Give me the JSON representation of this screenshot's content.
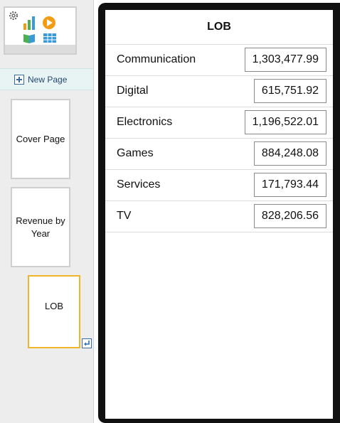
{
  "sidebar": {
    "new_page_label": "New Page",
    "pages": [
      {
        "label": "Cover Page"
      },
      {
        "label": "Revenue by Year"
      },
      {
        "label": "LOB"
      }
    ]
  },
  "table": {
    "header": "LOB",
    "rows": [
      {
        "name": "Communication",
        "value": "1,303,477.99"
      },
      {
        "name": "Digital",
        "value": "615,751.92"
      },
      {
        "name": "Electronics",
        "value": "1,196,522.01"
      },
      {
        "name": "Games",
        "value": "884,248.08"
      },
      {
        "name": "Services",
        "value": "171,793.44"
      },
      {
        "name": "TV",
        "value": "828,206.56"
      }
    ]
  },
  "colors": {
    "selected_border": "#f0b429",
    "new_page_text": "#24466f",
    "device_frame": "#111111"
  },
  "icons": [
    "gear-icon",
    "bar-chart-icon",
    "play-icon",
    "book-icon",
    "grid-icon",
    "plus-icon",
    "return-arrow-icon"
  ]
}
